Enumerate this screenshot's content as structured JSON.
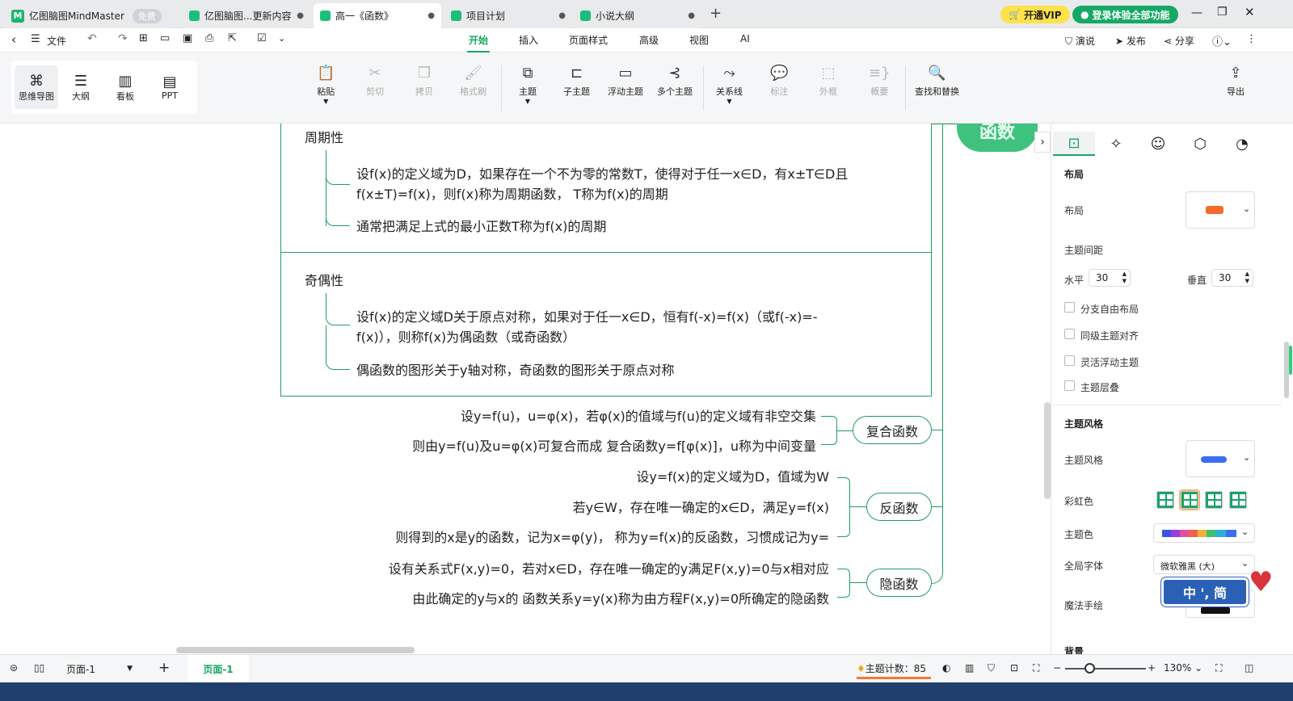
{
  "app": {
    "title": "亿图脑图MindMaster",
    "badge": "免费"
  },
  "tabs": [
    {
      "label": "亿图脑图...更新内容"
    },
    {
      "label": "高一《函数》"
    },
    {
      "label": "项目计划"
    },
    {
      "label": "小说大纲"
    }
  ],
  "titlebar": {
    "vip": "开通VIP",
    "login": "登录体验全部功能"
  },
  "menubar": {
    "file": "文件",
    "tabs": [
      "开始",
      "插入",
      "页面样式",
      "高级",
      "视图",
      "AI"
    ],
    "present": "演说",
    "publish": "发布",
    "share": "分享"
  },
  "views": [
    "思维导图",
    "大纲",
    "看板",
    "PPT"
  ],
  "ribbon": {
    "paste": "粘贴",
    "cut": "剪切",
    "copy": "拷贝",
    "format": "格式刷",
    "topic": "主题",
    "subtopic": "子主题",
    "float": "浮动主题",
    "multi": "多个主题",
    "relation": "关系线",
    "callout": "标注",
    "frame": "外框",
    "summary": "概要",
    "find": "查找和替换",
    "export": "导出"
  },
  "canvas": {
    "periodic": {
      "title": "周期性",
      "line1a": "设f(x)的定义域为D，如果存在一个不为零的常数T，使得对于任一x∈D，有x±T∈D且",
      "line1b": "f(x±T)=f(x)，则f(x)称为周期函数， T称为f(x)的周期",
      "line2": "通常把满足上式的最小正数T称为f(x)的周期"
    },
    "parity": {
      "title": "奇偶性",
      "line1a": "设f(x)的定义域D关于原点对称，如果对于任一x∈D，恒有f(-x)=f(x)（或f(-x)=-",
      "line1b": "f(x)），则称f(x)为偶函数（或奇函数）",
      "line2": "偶函数的图形关于y轴对称，奇函数的图形关于原点对称"
    },
    "composite": {
      "label": "复合函数",
      "line1": "设y=f(u)，u=φ(x)，若φ(x)的值域与f(u)的定义域有非空交集",
      "line2": "则由y=f(u)及u=φ(x)可复合而成 复合函数y=f[φ(x)]，u称为中间变量"
    },
    "inverse": {
      "label": "反函数",
      "line1": "设y=f(x)的定义域为D，值域为W",
      "line2": "若y∈W，存在唯一确定的x∈D，满足y=f(x)",
      "line3": "则得到的x是y的函数，记为x=φ(y)， 称为y=f(x)的反函数，习惯成记为y="
    },
    "implicit": {
      "label": "隐函数",
      "line1": "设有关系式F(x,y)=0，若对x∈D，存在唯一确定的y满足F(x,y)=0与x相对应",
      "line2": "由此确定的y与x的 函数关系y=y(x)称为由方程F(x,y)=0所确定的隐函数"
    },
    "root": "函数"
  },
  "panel": {
    "layout_section": "布局",
    "layout_label": "布局",
    "spacing_label": "主题间距",
    "horizontal_label": "水平",
    "horizontal_value": "30",
    "vertical_label": "垂直",
    "vertical_value": "30",
    "checks": [
      "分支自由布局",
      "同级主题对齐",
      "灵活浮动主题",
      "主题层叠"
    ],
    "style_section": "主题风格",
    "style_label": "主题风格",
    "rainbow_label": "彩虹色",
    "theme_color_label": "主题色",
    "font_label": "全局字体",
    "font_value": "微软雅黑 (大)",
    "magic_label": "魔法手绘",
    "bg_label": "背景",
    "ime": "中 ', 简"
  },
  "status": {
    "page_select": "页面-1",
    "page_tab": "页面-1",
    "count_label": "主题计数：",
    "count_value": "85",
    "zoom": "130%"
  }
}
